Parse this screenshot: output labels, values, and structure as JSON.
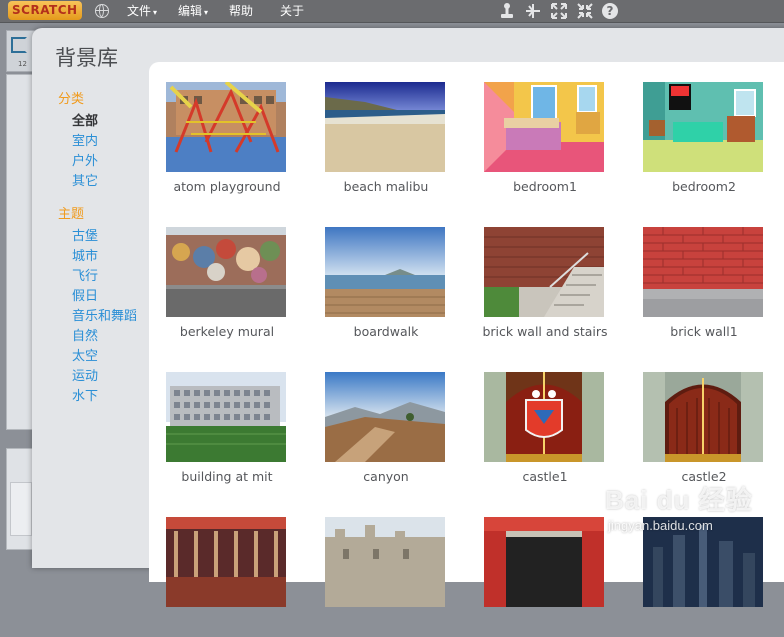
{
  "menubar": {
    "logo_text": "SCRATCH",
    "items": [
      {
        "label": "文件",
        "has_caret": true
      },
      {
        "label": "编辑",
        "has_caret": true
      },
      {
        "label": "帮助",
        "has_caret": false
      },
      {
        "label": "关于",
        "has_caret": false
      }
    ],
    "caret": "▾",
    "toolbar_icons": [
      "stamp-icon",
      "scissors-icon",
      "grow-icon",
      "shrink-icon",
      "help-icon"
    ],
    "help_glyph": "?"
  },
  "background_editor": {
    "stage_number": "12"
  },
  "dialog": {
    "title": "背景库",
    "sidebar": {
      "category_heading": "分类",
      "categories": [
        "全部",
        "室内",
        "户外",
        "其它"
      ],
      "selected": "全部",
      "theme_heading": "主题",
      "themes": [
        "古堡",
        "城市",
        "飞行",
        "假日",
        "音乐和舞蹈",
        "自然",
        "太空",
        "运动",
        "水下"
      ]
    },
    "backdrops": [
      {
        "label": "atom playground",
        "thumb": "playground"
      },
      {
        "label": "beach malibu",
        "thumb": "beach"
      },
      {
        "label": "bedroom1",
        "thumb": "bedroom1"
      },
      {
        "label": "bedroom2",
        "thumb": "bedroom2"
      },
      {
        "label": "berkeley mural",
        "thumb": "mural"
      },
      {
        "label": "boardwalk",
        "thumb": "boardwalk"
      },
      {
        "label": "brick wall and stairs",
        "thumb": "stairs"
      },
      {
        "label": "brick wall1",
        "thumb": "brickwall"
      },
      {
        "label": "building at mit",
        "thumb": "mit"
      },
      {
        "label": "canyon",
        "thumb": "canyon"
      },
      {
        "label": "castle1",
        "thumb": "castle1"
      },
      {
        "label": "castle2",
        "thumb": "castle2"
      },
      {
        "label": "",
        "thumb": "hall"
      },
      {
        "label": "",
        "thumb": "ruins"
      },
      {
        "label": "",
        "thumb": "theater"
      },
      {
        "label": "",
        "thumb": "city"
      }
    ]
  },
  "watermark": {
    "logo": "Bai du 经验",
    "url": "jingyan.baidu.com"
  },
  "colors": {
    "menubar": "#6b6c6f",
    "dialog": "#e3e5e8",
    "heading_orange": "#f09b1e",
    "link_blue": "#2a8fd6"
  }
}
